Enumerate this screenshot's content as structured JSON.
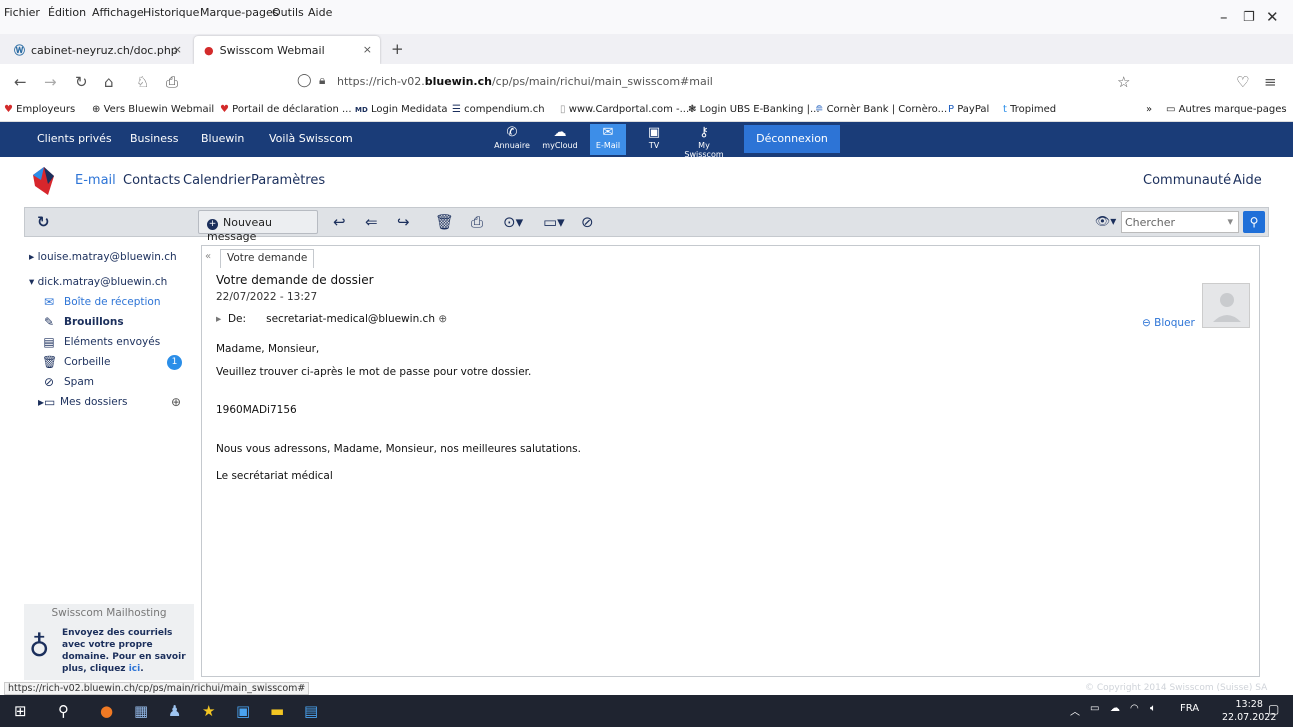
{
  "browser": {
    "menu": [
      "Fichier",
      "Édition",
      "Affichage",
      "Historique",
      "Marque-pages",
      "Outils",
      "Aide"
    ],
    "tabs": [
      {
        "label": "cabinet-neyruz.ch/doc.php"
      },
      {
        "label": "Swisscom Webmail"
      }
    ],
    "new_tab": "+",
    "tab_close": "×",
    "url_prefix": "https://rich-v02.",
    "url_domain": "bluewin.ch",
    "url_suffix": "/cp/ps/main/richui/main_swisscom#mail",
    "bookmarks": [
      "Employeurs",
      "Vers Bluewin Webmail",
      "Portail de déclaration ...",
      "Login Medidata",
      "compendium.ch",
      "www.Cardportal.com -...",
      "Login UBS E-Banking |...",
      "Cornèr Bank | Cornèro...",
      "PayPal",
      "Tropimed"
    ],
    "md_tag": "MD",
    "other_bookmarks": "Autres marque-pages"
  },
  "swisscom_nav": {
    "links": [
      "Clients privés",
      "Business",
      "Bluewin",
      "Voilà Swisscom"
    ],
    "services": [
      {
        "label": "Annuaire",
        "icon": "phone-icon"
      },
      {
        "label": "myCloud",
        "icon": "cloud-icon"
      },
      {
        "label": "E-Mail",
        "icon": "mail-icon"
      },
      {
        "label": "TV",
        "icon": "tv-icon"
      },
      {
        "label": "My Swisscom",
        "icon": "key-icon"
      }
    ],
    "logout": "Déconnexion"
  },
  "app_nav": {
    "items": [
      "E-mail",
      "Contacts",
      "Calendrier",
      "Paramètres"
    ],
    "right": [
      "Communauté",
      "Aide"
    ]
  },
  "toolbar": {
    "new_message": "Nouveau message",
    "search_placeholder": "Chercher"
  },
  "sidebar": {
    "accounts": [
      "louise.matray@bluewin.ch",
      "dick.matray@bluewin.ch"
    ],
    "folders": [
      {
        "label": "Boîte de réception",
        "icon": "inbox-icon"
      },
      {
        "label": "Brouillons",
        "icon": "drafts-icon"
      },
      {
        "label": "Eléments envoyés",
        "icon": "sent-icon"
      },
      {
        "label": "Corbeille",
        "icon": "trash-icon"
      },
      {
        "label": "Spam",
        "icon": "spam-icon"
      },
      {
        "label": "Mes dossiers",
        "icon": "folder-icon"
      }
    ],
    "trash_count": "1"
  },
  "promo": {
    "heading": "Swisscom Mailhosting",
    "text": "Envoyez des courriels avec votre propre domaine. Pour en savoir plus, cliquez ",
    "link": "ici",
    "end": "."
  },
  "message": {
    "tab": "Votre demande",
    "subject": "Votre demande de dossier",
    "date": "22/07/2022 - 13:27",
    "from_label": "De:",
    "from": "secretariat-medical@bluewin.ch",
    "block": "Bloquer",
    "body": [
      "Madame, Monsieur,",
      "Veuillez trouver ci-après le mot de passe pour votre dossier.",
      "1960MADi7156",
      "Nous vous adressons, Madame, Monsieur, nos meilleures salutations.",
      "Le secrétariat médical"
    ]
  },
  "status": {
    "url": "https://rich-v02.bluewin.ch/cp/ps/main/richui/main_swisscom#",
    "copyright": "© Copyright 2014 Swisscom (Suisse) SA"
  },
  "taskbar": {
    "lang": "FRA",
    "time": "13:28",
    "date": "22.07.2022"
  }
}
